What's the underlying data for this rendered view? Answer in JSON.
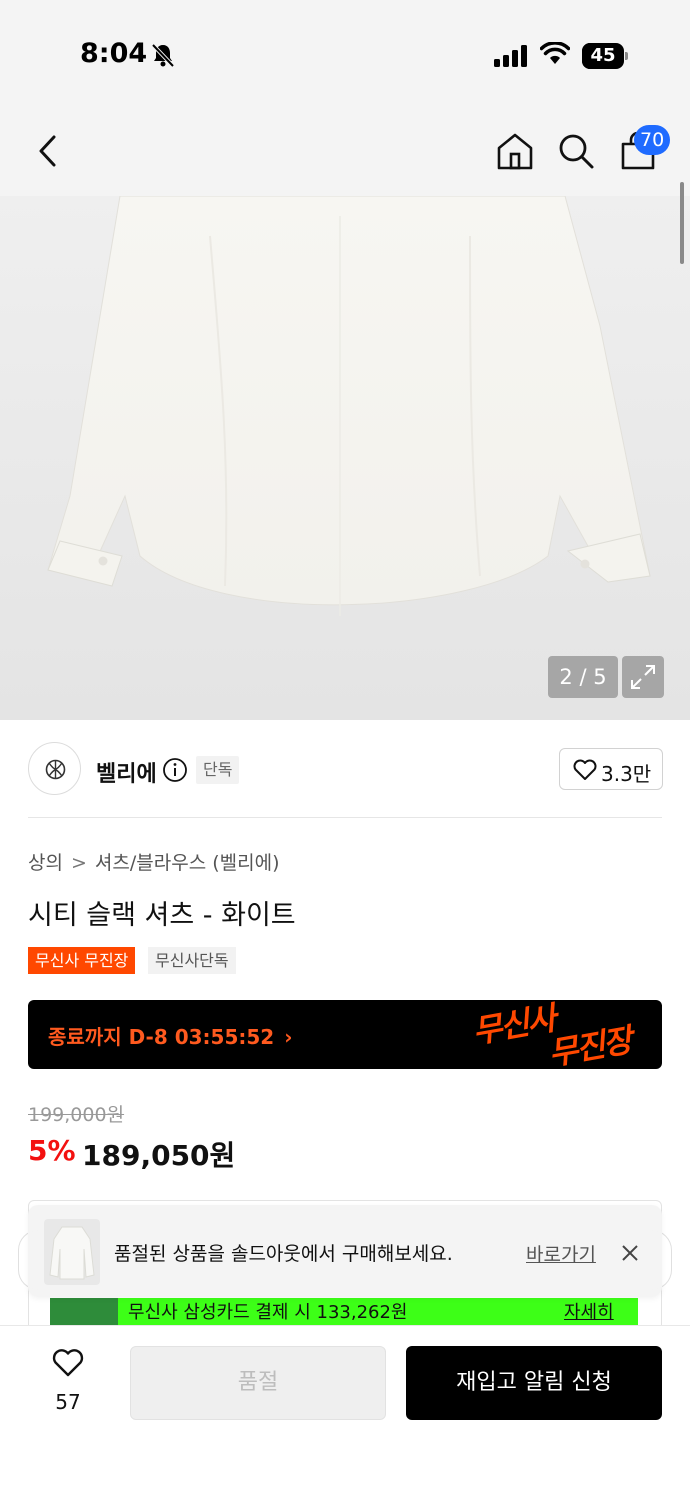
{
  "status_bar": {
    "time": "8:04",
    "battery": "45",
    "battery_level": 0.45
  },
  "nav": {
    "cart_count": "70"
  },
  "gallery": {
    "counter": "2 / 5"
  },
  "brand": {
    "name": "벨리에",
    "tag": "단독",
    "like_count": "3.3만"
  },
  "breadcrumb": {
    "category": "상의",
    "separator": ">",
    "subcategory": "셔츠/블라우스 (벨리에)"
  },
  "product": {
    "title": "시티 슬랙 셔츠 - 화이트",
    "tags": [
      "무신사 무진장",
      "무신사단독"
    ],
    "original_price": "199,000원",
    "discount_rate": "5%",
    "sale_price": "189,050원"
  },
  "event_banner": {
    "countdown": "종료까지 D-8 03:55:52",
    "logo_line1": "무신사",
    "logo_line2": "무진장"
  },
  "card_promo": {
    "text": "무신사 삼성카드 결제 시 133,262원",
    "link": "자세히"
  },
  "toast": {
    "message": "품절된 상품을 솔드아웃에서 구매해보세요.",
    "link": "바로가기"
  },
  "bottom_bar": {
    "wish_count": "57",
    "soldout_label": "품절",
    "restock_label": "재입고 알림 신청"
  },
  "colors": {
    "accent_orange": "#ff4800",
    "discount_red": "#f31110",
    "badge_blue": "#1f6bff",
    "promo_green": "#3dff17"
  }
}
